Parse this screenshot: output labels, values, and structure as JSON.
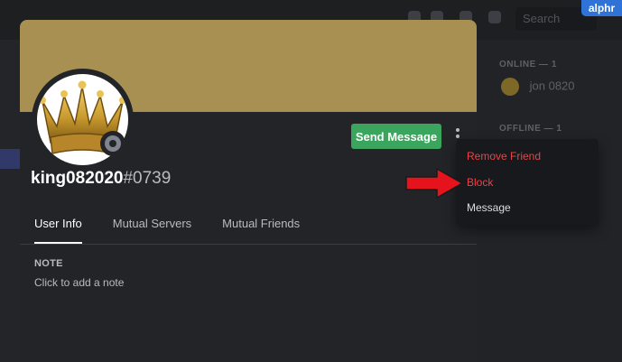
{
  "profile": {
    "username": "king082020",
    "discriminator": "#0739",
    "send_message_label": "Send Message"
  },
  "tabs": [
    {
      "label": "User Info",
      "active": true
    },
    {
      "label": "Mutual Servers",
      "active": false
    },
    {
      "label": "Mutual Friends",
      "active": false
    }
  ],
  "note": {
    "title": "NOTE",
    "placeholder": "Click to add a note"
  },
  "context_menu": {
    "items": [
      {
        "label": "Remove Friend",
        "color": "#ed4245"
      },
      {
        "label": "Block",
        "color": "#ed4245"
      },
      {
        "label": "Message",
        "color": "#dcddde"
      }
    ]
  },
  "background": {
    "online_header": "ONLINE — 1",
    "offline_header": "OFFLINE — 1",
    "online_member": "jon 0820",
    "search_placeholder": "Search"
  },
  "watermark": "alphr",
  "colors": {
    "banner": "#a88f52",
    "send_button": "#3ba55d",
    "danger": "#ed4245",
    "arrow": "#e5131b"
  }
}
